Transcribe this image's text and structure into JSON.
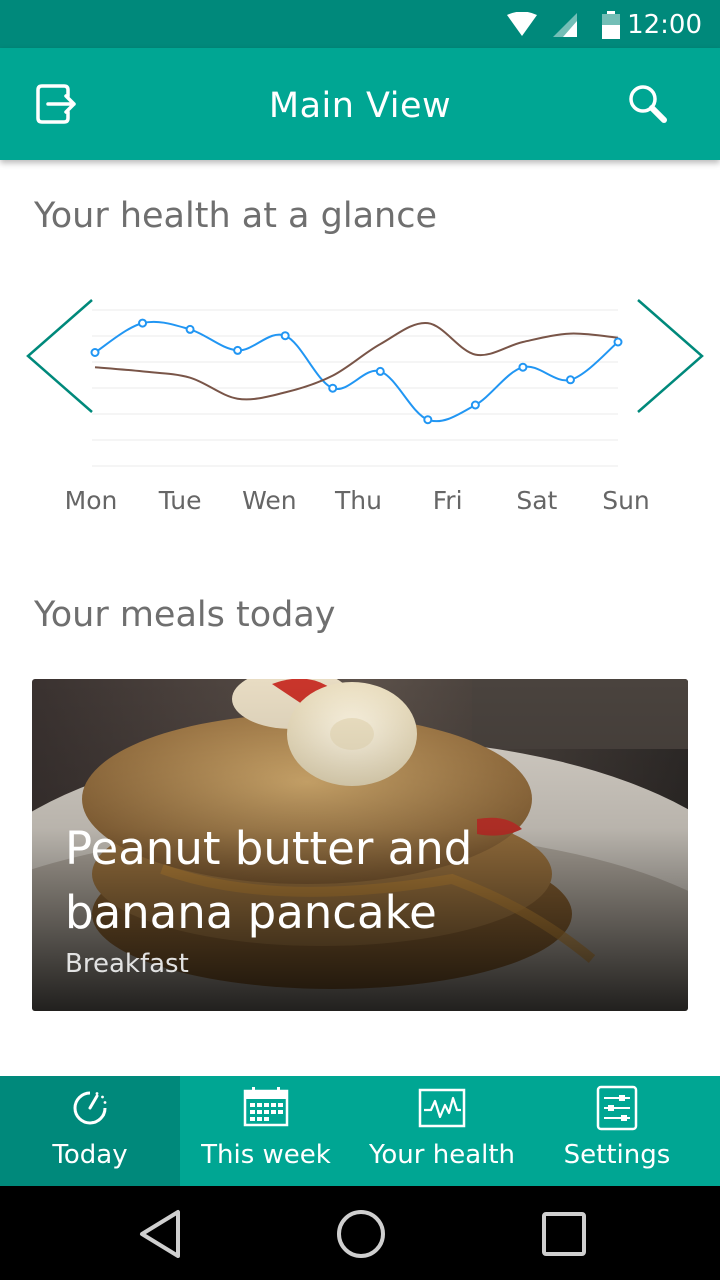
{
  "status_bar": {
    "time": "12:00"
  },
  "app_bar": {
    "title": "Main View"
  },
  "health": {
    "heading": "Your health at a glance",
    "chart_data": {
      "type": "line",
      "title": "",
      "categories": [
        "Mon",
        "Tue",
        "Wen",
        "Thu",
        "Fri",
        "Sat",
        "Sun"
      ],
      "series": [
        {
          "values": [
            5.5,
            6.9,
            6.6,
            5.6,
            6.3,
            3.8,
            4.6,
            2.3,
            3.0,
            4.8,
            4.2,
            6.0
          ],
          "color": "#2196f3"
        },
        {
          "values": [
            4.8,
            4.6,
            4.3,
            3.3,
            3.6,
            4.4,
            5.9,
            6.9,
            5.4,
            6.0,
            6.4,
            6.2
          ],
          "color": "#795548"
        }
      ],
      "grid": true,
      "legend": "none",
      "colors": {
        "primary": "#00a693",
        "dark": "#00897b",
        "blue": "#2196f3",
        "brown": "#795548"
      }
    }
  },
  "meals": {
    "heading": "Your meals today",
    "card": {
      "title": "Peanut butter and banana pancake",
      "category": "Breakfast"
    }
  },
  "bottom_nav": {
    "items": [
      {
        "label": "Today",
        "icon": "clock-icon",
        "active": true
      },
      {
        "label": "This week",
        "icon": "calendar-icon",
        "active": false
      },
      {
        "label": "Your health",
        "icon": "health-chart-icon",
        "active": false
      },
      {
        "label": "Settings",
        "icon": "settings-sliders-icon",
        "active": false
      }
    ]
  }
}
